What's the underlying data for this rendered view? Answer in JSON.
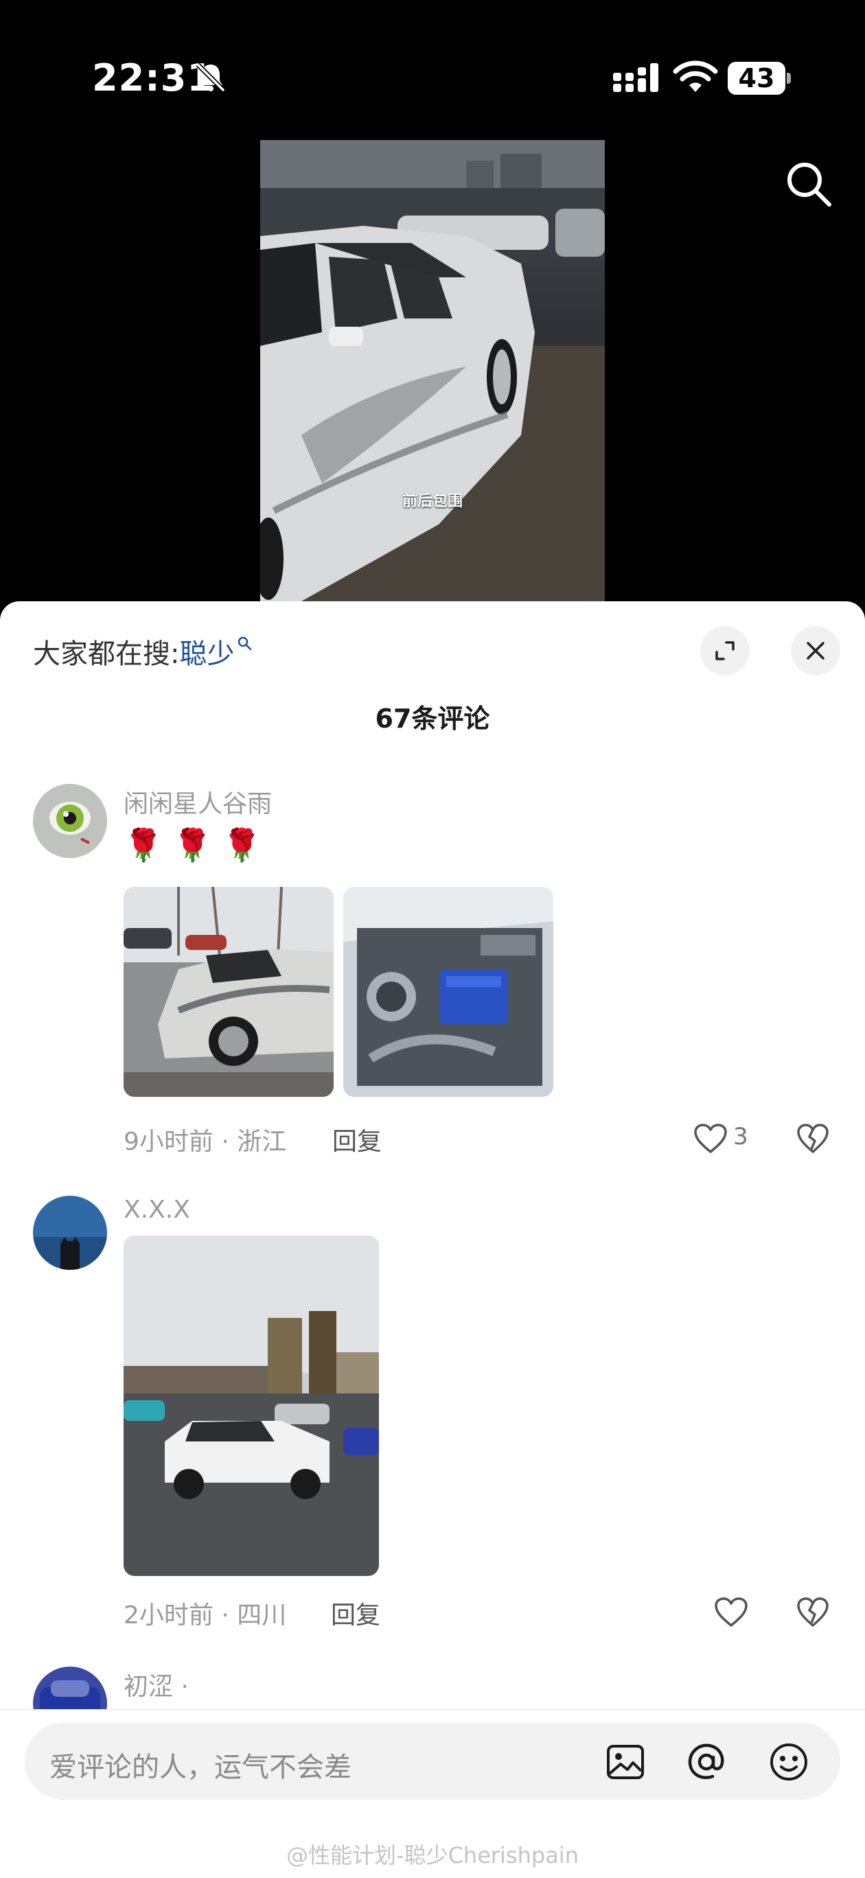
{
  "status_bar": {
    "time": "22:31",
    "battery": "43"
  },
  "video": {
    "caption": "前后包围"
  },
  "sheet": {
    "hot_search_prefix": "大家都在搜:",
    "hot_search_keyword": "聪少",
    "comment_count": "67条评论"
  },
  "comments": [
    {
      "username": "闲闲星人谷雨",
      "emoji": "🌹 🌹 🌹",
      "time_location": "9小时前 · 浙江",
      "reply_label": "回复",
      "likes": "3",
      "icons": [
        "heart-icon",
        "broken-heart-icon"
      ]
    },
    {
      "username": "X.X.X",
      "time_location": "2小时前 · 四川",
      "reply_label": "回复",
      "likes": "",
      "icons": [
        "heart-icon",
        "broken-heart-icon"
      ]
    },
    {
      "username": "初涩 ·"
    }
  ],
  "input": {
    "placeholder": "爱评论的人，运气不会差",
    "icons": [
      "image-icon",
      "at-icon",
      "emoji-icon"
    ]
  },
  "watermark": "@性能计划-聪少Cherishpain",
  "colors": {
    "keyword": "#1b4fa0",
    "sheet_bg": "#ffffff",
    "page_bg": "#000000"
  }
}
